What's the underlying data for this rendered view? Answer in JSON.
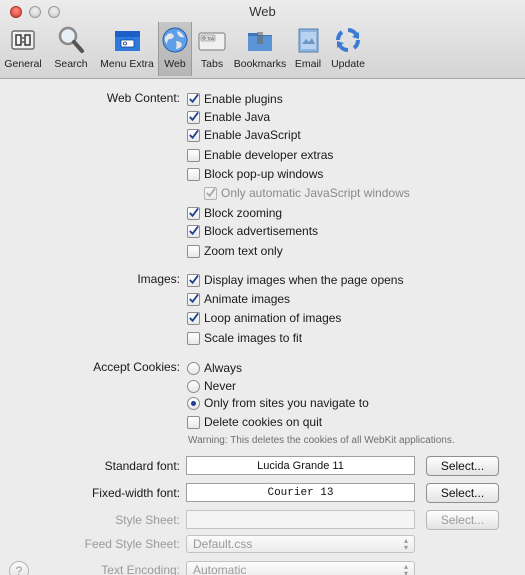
{
  "window": {
    "title": "Web"
  },
  "toolbar": {
    "items": [
      {
        "label": "General",
        "icon": "general-icon"
      },
      {
        "label": "Search",
        "icon": "magnifier-icon"
      },
      {
        "label": "Menu Extra",
        "icon": "menu-extra-icon"
      },
      {
        "label": "Web",
        "icon": "globe-icon",
        "selected": true
      },
      {
        "label": "Tabs",
        "icon": "tabs-icon"
      },
      {
        "label": "Bookmarks",
        "icon": "folder-icon"
      },
      {
        "label": "Email",
        "icon": "email-icon"
      },
      {
        "label": "Update",
        "icon": "update-icon"
      }
    ],
    "tabs_icon_text": "Tab"
  },
  "web_content": {
    "label": "Web Content:",
    "options": [
      {
        "label": "Enable plugins",
        "checked": true
      },
      {
        "label": "Enable Java",
        "checked": true
      },
      {
        "label": "Enable JavaScript",
        "checked": true
      },
      {
        "label": "Enable developer extras",
        "checked": false
      },
      {
        "label": "Block pop-up windows",
        "checked": false
      },
      {
        "label": "Only automatic JavaScript windows",
        "checked": true,
        "disabled": true
      },
      {
        "label": "Block zooming",
        "checked": true
      },
      {
        "label": "Block advertisements",
        "checked": true
      },
      {
        "label": "Zoom text only",
        "checked": false
      }
    ]
  },
  "images": {
    "label": "Images:",
    "options": [
      {
        "label": "Display images when the page opens",
        "checked": true
      },
      {
        "label": "Animate images",
        "checked": true
      },
      {
        "label": "Loop animation of images",
        "checked": true
      },
      {
        "label": "Scale images to fit",
        "checked": false
      }
    ]
  },
  "cookies": {
    "label": "Accept Cookies:",
    "options": [
      {
        "label": "Always",
        "selected": false
      },
      {
        "label": "Never",
        "selected": false
      },
      {
        "label": "Only from sites you navigate to",
        "selected": true
      }
    ],
    "delete_label": "Delete cookies on quit",
    "delete_checked": false,
    "warning": "Warning: This deletes the cookies of all WebKit applications."
  },
  "fonts": {
    "standard_label": "Standard font:",
    "standard_value": "Lucida Grande 11",
    "fixed_label": "Fixed-width font:",
    "fixed_value": "Courier 13",
    "stylesheet_label": "Style Sheet:",
    "stylesheet_value": "",
    "select_label": "Select..."
  },
  "feed": {
    "label": "Feed Style Sheet:",
    "value": "Default.css"
  },
  "encoding": {
    "label": "Text Encoding:",
    "value": "Automatic"
  },
  "help": {
    "label": "?"
  }
}
